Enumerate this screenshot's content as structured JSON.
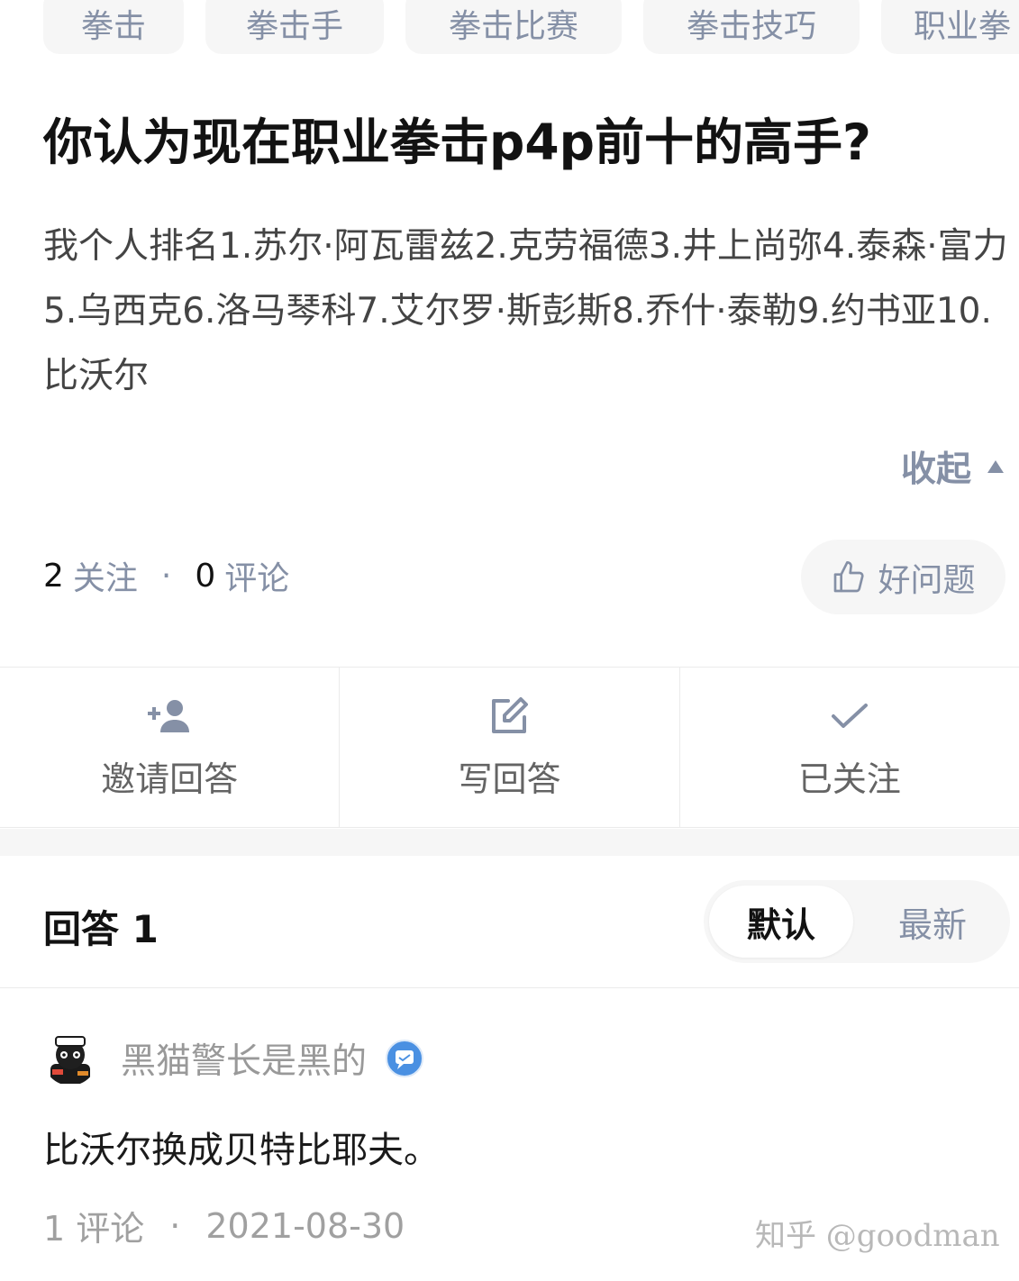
{
  "tags": [
    "拳击",
    "拳击手",
    "拳击比赛",
    "拳击技巧",
    "职业拳"
  ],
  "question": {
    "title": "你认为现在职业拳击p4p前十的高手?",
    "description": "我个人排名1.苏尔·阿瓦雷兹2.克劳福德3.井上尚弥4.泰森·富力5.乌西克6.洛马琴科7.艾尔罗·斯彭斯8.乔什·泰勒9.约书亚10.比沃尔",
    "collapse_label": "收起",
    "followers_count": "2",
    "followers_label": "关注",
    "separator": "·",
    "comments_count": "0",
    "comments_label": "评论",
    "good_question_label": "好问题"
  },
  "actions": {
    "invite_label": "邀请回答",
    "write_label": "写回答",
    "follow_label": "已关注"
  },
  "answers": {
    "title": "回答 1",
    "sort_default": "默认",
    "sort_latest": "最新",
    "items": [
      {
        "author": "黑猫警长是黑的",
        "content": "比沃尔换成贝特比耶夫。",
        "comments": "1 评论",
        "separator": "·",
        "date": "2021-08-30"
      }
    ]
  },
  "watermark": "知乎 @goodman",
  "colors": {
    "muted": "#8590a6",
    "tag_bg": "#f6f6f6",
    "title": "#121212",
    "badge_blue": "#4a90e2"
  },
  "icons": [
    "thumb-up-icon",
    "add-user-icon",
    "edit-icon",
    "check-icon",
    "triangle-up-icon",
    "verified-badge-icon"
  ]
}
